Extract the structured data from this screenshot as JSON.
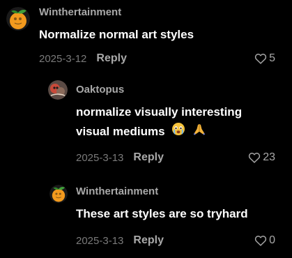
{
  "comments": [
    {
      "username": "Winthertainment",
      "text": "Normalize normal art styles",
      "date": "2025-3-12",
      "reply_label": "Reply",
      "likes": "5",
      "avatar_icon": "orange-fruit-avatar"
    },
    {
      "username": "Oaktopus",
      "text_line1": "normalize visually interesting",
      "text_line2": "visual mediums",
      "emojis": [
        "crying-face-emoji",
        "folded-hands-emoji"
      ],
      "date": "2025-3-13",
      "reply_label": "Reply",
      "likes": "23",
      "avatar_icon": "creature-avatar"
    },
    {
      "username": "Winthertainment",
      "text": "These art styles are so tryhard",
      "date": "2025-3-13",
      "reply_label": "Reply",
      "likes": "0",
      "avatar_icon": "orange-fruit-avatar"
    }
  ],
  "colors": {
    "background": "#000000",
    "username": "#a9a9a9",
    "date": "#7a7a7a",
    "text": "#ffffff"
  }
}
